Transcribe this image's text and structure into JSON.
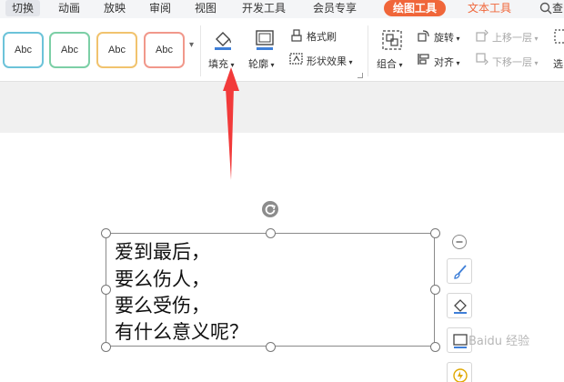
{
  "menu": {
    "tabs": [
      {
        "label": "切换"
      },
      {
        "label": "动画"
      },
      {
        "label": "放映"
      },
      {
        "label": "审阅"
      },
      {
        "label": "视图"
      },
      {
        "label": "开发工具"
      },
      {
        "label": "会员专享"
      },
      {
        "label": "绘图工具"
      },
      {
        "label": "文本工具"
      }
    ],
    "search_label": "查"
  },
  "ribbon": {
    "shape_styles": [
      "Abc",
      "Abc",
      "Abc",
      "Abc"
    ],
    "shape_style_colors": [
      "#6cc3d9",
      "#7ccfa6",
      "#f1c36e",
      "#f1988b"
    ],
    "fill_label": "填充",
    "outline_label": "轮廓",
    "format_painter_label": "格式刷",
    "shape_effects_label": "形状效果",
    "group_label": "组合",
    "rotate_label": "旋转",
    "align_label": "对齐",
    "bring_forward_label": "上移一层",
    "send_backward_label": "下移一层",
    "select_label": "选"
  },
  "textbox": {
    "lines": [
      "爱到最后，",
      "要么伤人，",
      "要么受伤，",
      "有什么意义呢？"
    ]
  },
  "watermark": "Baidu 经验",
  "colors": {
    "accent_orange": "#f0663a",
    "arrow_red": "#f23a3a",
    "fill_underline": "#3f7fd8"
  }
}
